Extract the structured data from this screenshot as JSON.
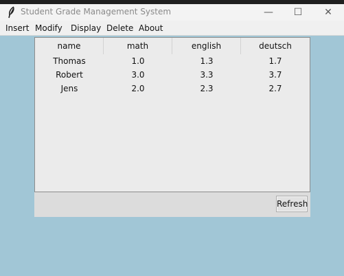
{
  "window": {
    "title": "Student Grade Management System",
    "minimize": "—",
    "maximize": "☐",
    "close": "✕"
  },
  "menu": [
    "Insert",
    "Modify",
    "Display",
    "Delete",
    "About"
  ],
  "table": {
    "columns": [
      "name",
      "math",
      "english",
      "deutsch"
    ],
    "rows": [
      [
        "Thomas",
        "1.0",
        "1.3",
        "1.7"
      ],
      [
        "Robert",
        "3.0",
        "3.3",
        "3.7"
      ],
      [
        "Jens",
        "2.0",
        "2.3",
        "2.7"
      ]
    ]
  },
  "buttons": {
    "refresh": "Refresh"
  },
  "colors": {
    "background": "#a1c6d6",
    "panel": "#e8e8e8"
  }
}
